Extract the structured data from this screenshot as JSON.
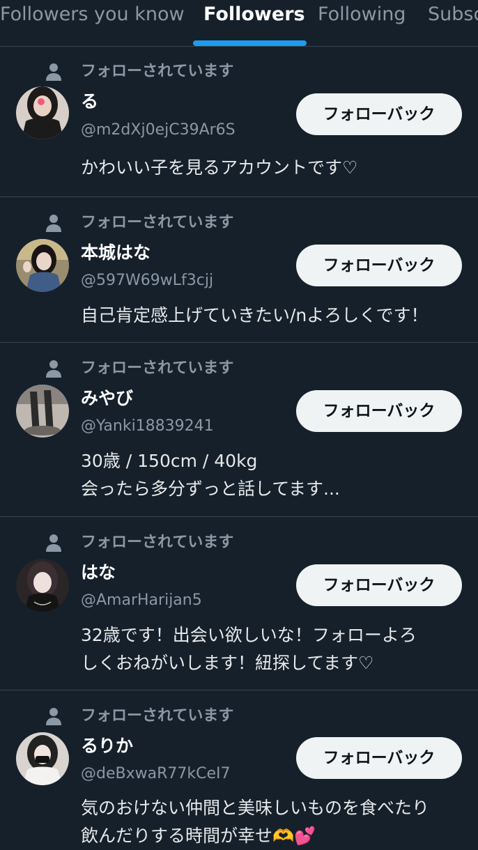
{
  "tabs": [
    {
      "label": "Followers you know",
      "active": false
    },
    {
      "label": "Followers",
      "active": true
    },
    {
      "label": "Following",
      "active": false
    },
    {
      "label": "Subscriptions",
      "active": false
    }
  ],
  "followed_by_label": "フォローされています",
  "follow_back_label": "フォローバック",
  "colors": {
    "background": "#15202b",
    "accent": "#1d9bf0",
    "muted_text": "#8b98a5",
    "button_bg": "#eff3f4",
    "divider": "#38444d"
  },
  "users": [
    {
      "name": "る",
      "handle": "@m2dXj0ejC39Ar6S",
      "bio": "かわいい子を見るアカウントです♡"
    },
    {
      "name": "本城はな",
      "handle": "@597W69wLf3cjj",
      "bio": "自己肯定感上げていきたい/nよろしくです！"
    },
    {
      "name": "みやび",
      "handle": "@Yanki18839241",
      "bio": "30歳 / 150cm / 40kg\n会ったら多分ずっと話してます..."
    },
    {
      "name": "はな",
      "handle": "@AmarHarijan5",
      "bio": "32歳です！出会い欲しいな！フォローよろ\nしくおねがいします！紐探してます♡"
    },
    {
      "name": "るりか",
      "handle": "@deBxwaR77kCeI7",
      "bio": "気のおけない仲間と美味しいものを食べたり\n飲んだりする時間が幸せ🫶💕"
    }
  ]
}
